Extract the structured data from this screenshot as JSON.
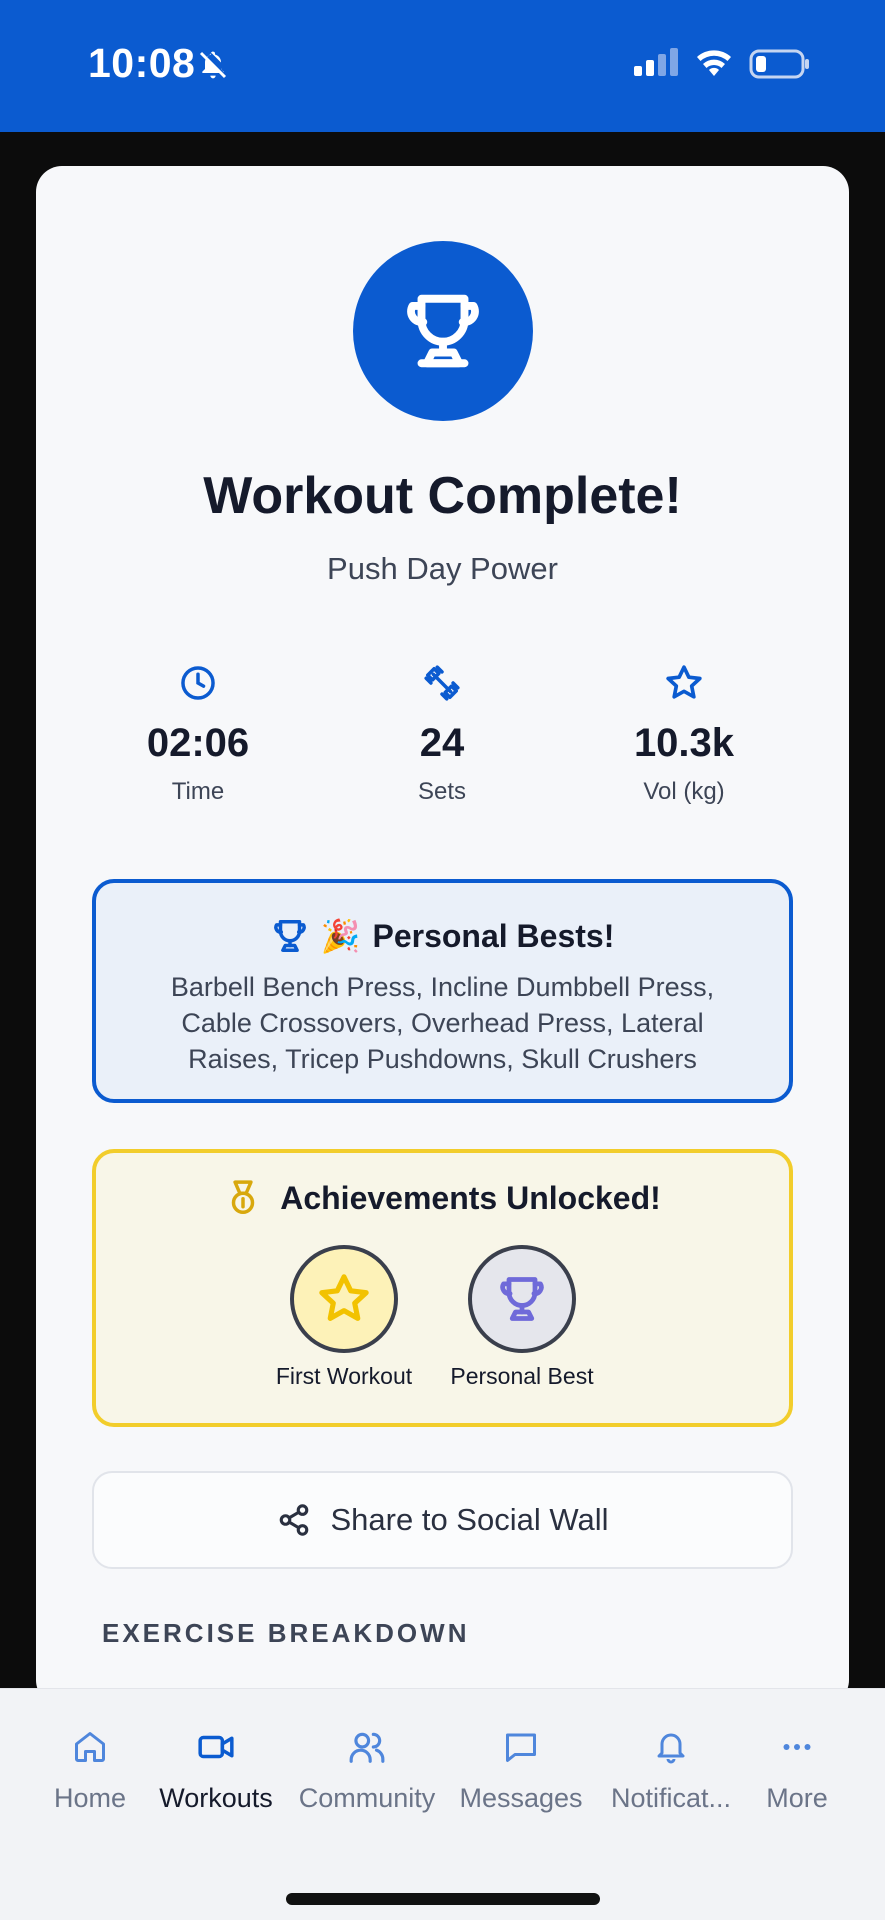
{
  "status_bar": {
    "time": "10:08",
    "bg": "#0b5bd0"
  },
  "hero": {
    "title": "Workout Complete!",
    "subtitle": "Push Day Power"
  },
  "stats": [
    {
      "icon": "clock-icon",
      "value": "02:06",
      "label": "Time"
    },
    {
      "icon": "dumbbell-icon",
      "value": "24",
      "label": "Sets"
    },
    {
      "icon": "star-icon",
      "value": "10.3k",
      "label": "Vol (kg)"
    }
  ],
  "personal_bests": {
    "emoji": "🎉",
    "title": "Personal Bests!",
    "text": "Barbell Bench Press, Incline Dumbbell Press, Cable Crossovers, Overhead Press, Lateral Raises, Tricep Pushdowns, Skull Crushers",
    "accent": "#0b5bd0"
  },
  "achievements": {
    "title": "Achievements Unlocked!",
    "accent": "#f2cd2b",
    "badges": [
      {
        "label": "First Workout",
        "icon": "star-icon"
      },
      {
        "label": "Personal Best",
        "icon": "trophy-icon"
      }
    ]
  },
  "share": {
    "label": "Share to Social Wall"
  },
  "breakdown": {
    "title": "EXERCISE BREAKDOWN"
  },
  "tabs": [
    {
      "label": "Home",
      "icon": "home-icon"
    },
    {
      "label": "Workouts",
      "icon": "video-icon",
      "active": true
    },
    {
      "label": "Community",
      "icon": "users-icon"
    },
    {
      "label": "Messages",
      "icon": "chat-icon"
    },
    {
      "label": "Notificat...",
      "icon": "bell-icon"
    },
    {
      "label": "More",
      "icon": "more-icon"
    }
  ]
}
